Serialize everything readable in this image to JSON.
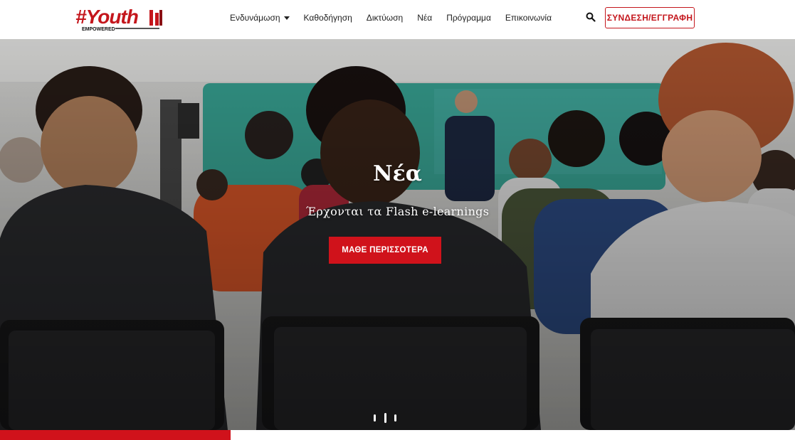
{
  "header": {
    "logo": {
      "text": "#Youth",
      "subtext": "EMPOWERED",
      "brand_color": "#c4161c"
    },
    "nav": [
      {
        "label": "Ενδυνάμωση",
        "has_dropdown": true
      },
      {
        "label": "Καθοδήγηση",
        "has_dropdown": false
      },
      {
        "label": "Δικτύωση",
        "has_dropdown": false
      },
      {
        "label": "Νέα",
        "has_dropdown": false
      },
      {
        "label": "Πρόγραμμα",
        "has_dropdown": false
      },
      {
        "label": "Επικοινωνία",
        "has_dropdown": false
      }
    ],
    "search_icon": "search-icon",
    "login_label": "ΣΥΝΔΕΣΗ/ΕΓΓΡΑΦΗ"
  },
  "hero": {
    "title": "Νέα",
    "subtitle": "Έρχονται τα Flash e-learnings",
    "cta_label": "ΜΑΘΕ ΠΕΡΙΣΣΟΤΕΡΑ",
    "accent_color": "#d0121b",
    "slides_count": 3,
    "active_slide": 2
  },
  "progress": {
    "fraction": 0.29
  }
}
